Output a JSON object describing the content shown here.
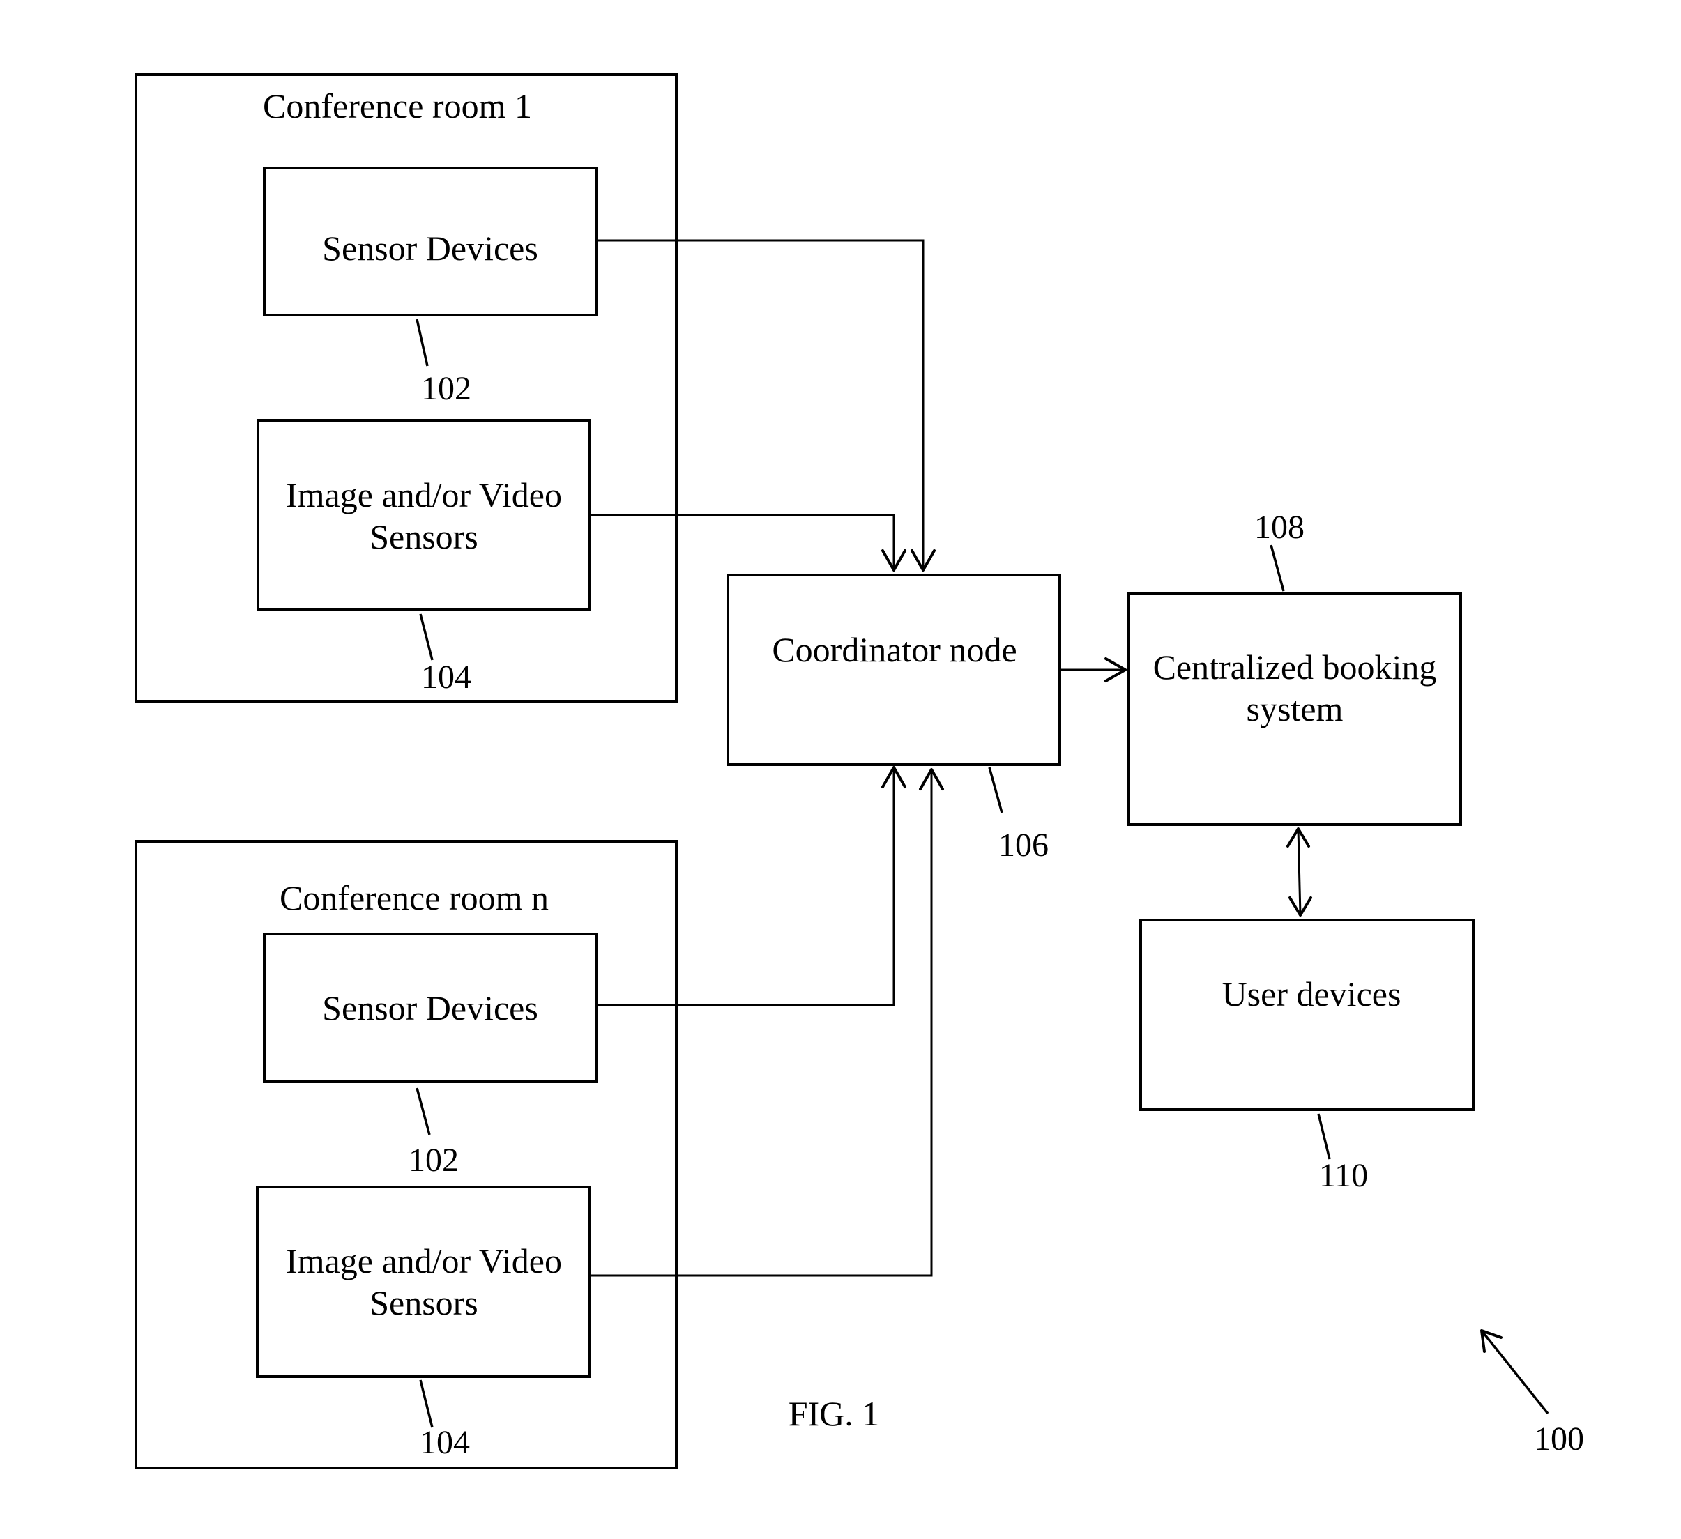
{
  "figure": {
    "caption": "FIG. 1",
    "reference_numeral": "100"
  },
  "rooms": [
    {
      "title": "Conference room 1",
      "sensor_devices": {
        "label": "Sensor Devices",
        "ref": "102"
      },
      "image_video_sensors": {
        "label_line1": "Image and/or Video",
        "label_line2": "Sensors",
        "ref": "104"
      }
    },
    {
      "title": "Conference room n",
      "sensor_devices": {
        "label": "Sensor Devices",
        "ref": "102"
      },
      "image_video_sensors": {
        "label_line1": "Image and/or Video",
        "label_line2": "Sensors",
        "ref": "104"
      }
    }
  ],
  "coordinator": {
    "label": "Coordinator node",
    "ref": "106"
  },
  "booking": {
    "label_line1": "Centralized booking",
    "label_line2": "system",
    "ref": "108"
  },
  "user_devices": {
    "label": "User devices",
    "ref": "110"
  },
  "connections": [
    {
      "from": "Sensor Devices (room 1)",
      "to": "Coordinator node",
      "direction": "one-way"
    },
    {
      "from": "Image and/or Video Sensors (room 1)",
      "to": "Coordinator node",
      "direction": "one-way"
    },
    {
      "from": "Sensor Devices (room n)",
      "to": "Coordinator node",
      "direction": "one-way"
    },
    {
      "from": "Image and/or Video Sensors (room n)",
      "to": "Coordinator node",
      "direction": "one-way"
    },
    {
      "from": "Coordinator node",
      "to": "Centralized booking system",
      "direction": "one-way"
    },
    {
      "from": "Centralized booking system",
      "to": "User devices",
      "direction": "bidirectional"
    }
  ]
}
